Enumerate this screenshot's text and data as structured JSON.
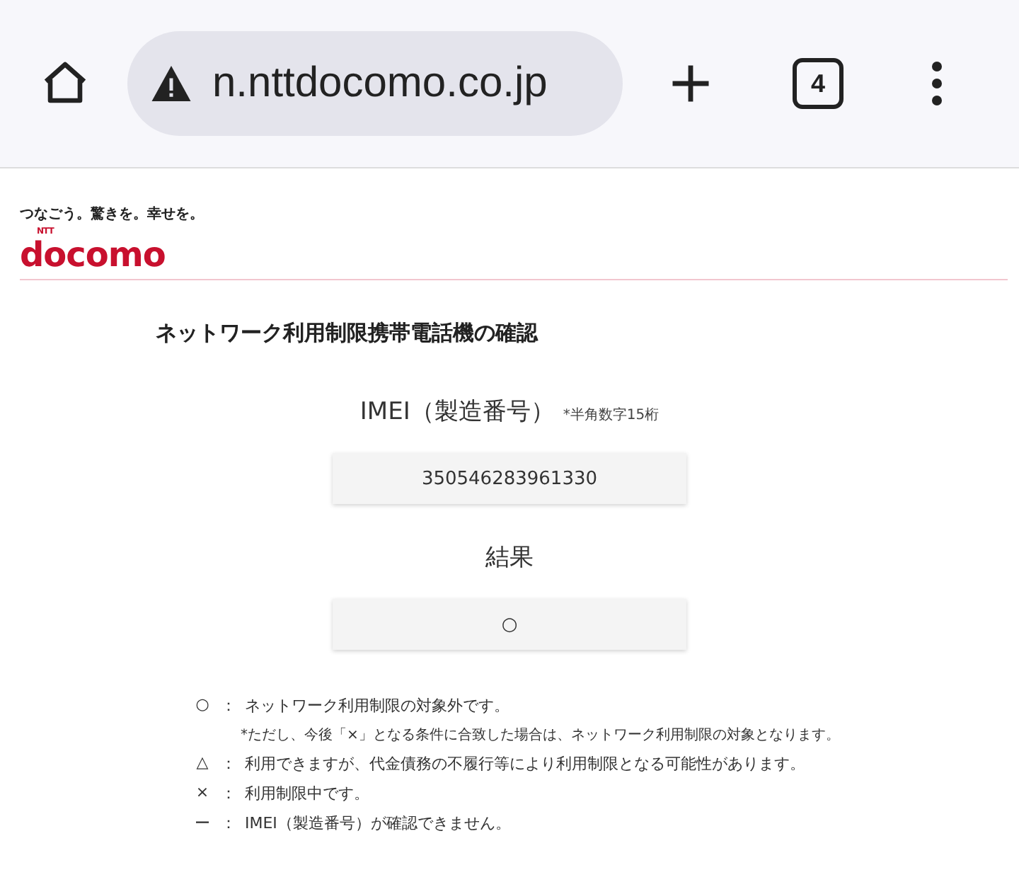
{
  "browser": {
    "url": "n.nttdocomo.co.jp",
    "tab_count": "4"
  },
  "header": {
    "tagline": "つなごう。驚きを。幸せを。",
    "logo_small": "NTT",
    "logo": "docomo"
  },
  "title": "ネットワーク利用制限携帯電話機の確認",
  "imei": {
    "label": "IMEI（製造番号）",
    "note": "*半角数字15桁",
    "value": "350546283961330"
  },
  "result": {
    "label": "結果",
    "value": "○"
  },
  "legend": [
    {
      "symbol": "○",
      "sep": "：",
      "text": "ネットワーク利用制限の対象外です。",
      "note": "*ただし、今後「×」となる条件に合致した場合は、ネットワーク利用制限の対象となります。"
    },
    {
      "symbol": "△",
      "sep": "：",
      "text": "利用できますが、代金債務の不履行等により利用制限となる可能性があります。"
    },
    {
      "symbol": "×",
      "sep": "：",
      "text": "利用制限中です。"
    },
    {
      "symbol": "ー",
      "sep": "：",
      "text": "IMEI（製造番号）が確認できません。"
    }
  ]
}
